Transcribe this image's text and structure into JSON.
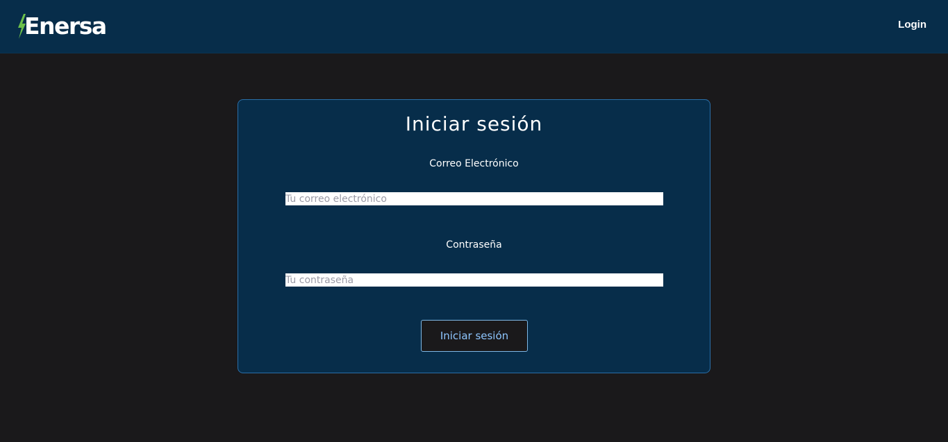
{
  "header": {
    "brand": "Enersa",
    "nav_login": "Login"
  },
  "login_form": {
    "title": "Iniciar sesión",
    "email": {
      "label": "Correo Electrónico",
      "placeholder": "Tu correo electrónico",
      "value": ""
    },
    "password": {
      "label": "Contraseña",
      "placeholder": "Tu contraseña",
      "value": ""
    },
    "submit_label": "Iniciar sesión"
  },
  "colors": {
    "page_background": "#1a191b",
    "navbar_background": "#072d4a",
    "card_background": "#072d4a",
    "card_border": "#2a6fa8",
    "button_text": "#8ec6ff",
    "logo_bolt": "#6cc04a"
  },
  "icons": {
    "logo_mark": "lightning-bolt-icon"
  }
}
